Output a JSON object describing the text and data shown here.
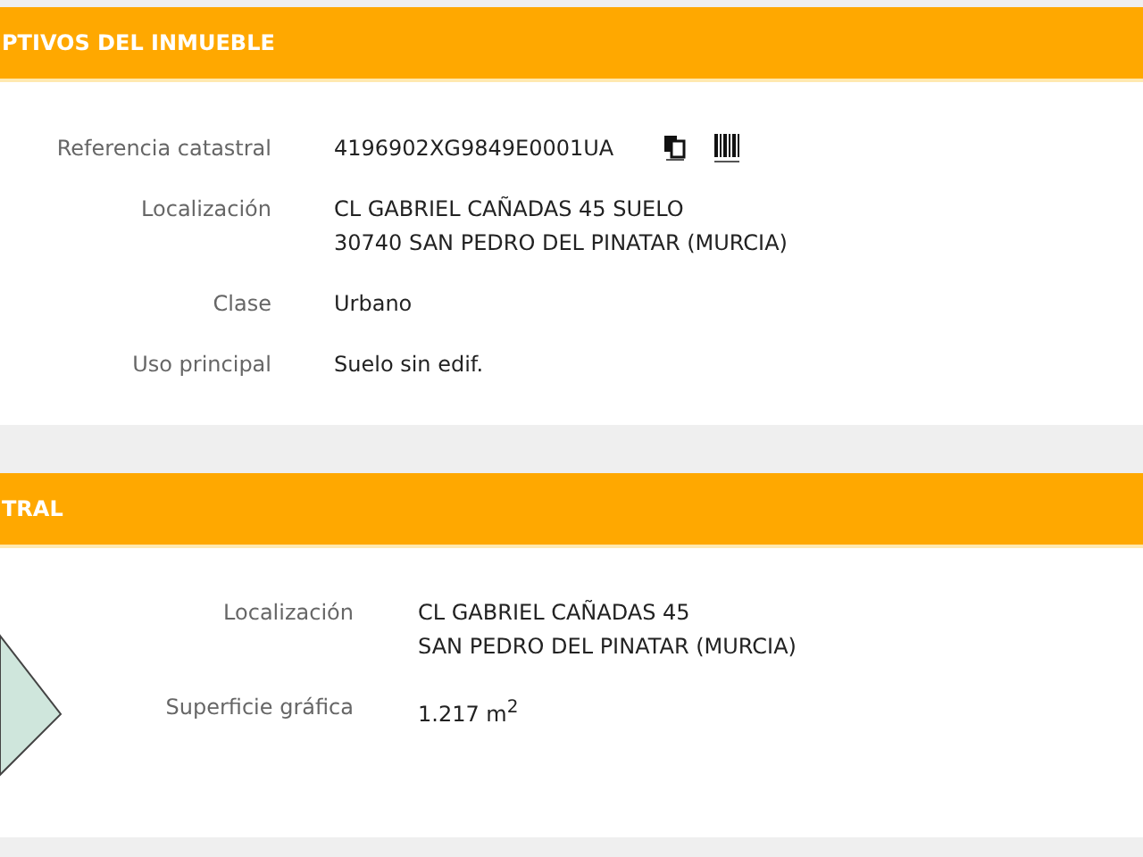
{
  "sections": [
    {
      "title": "PTIVOS DEL INMUEBLE",
      "kind": "plain",
      "fields": [
        {
          "label": "Referencia catastral",
          "kind": "reference",
          "lines": [
            "4196902XG9849E0001UA"
          ]
        },
        {
          "label": "Localización",
          "kind": "text",
          "lines": [
            "CL GABRIEL CAÑADAS 45 SUELO",
            "30740 SAN PEDRO DEL PINATAR (MURCIA)"
          ]
        },
        {
          "label": "Clase",
          "kind": "text",
          "lines": [
            "Urbano"
          ]
        },
        {
          "label": "Uso principal",
          "kind": "text",
          "lines": [
            "Suelo sin edif."
          ]
        }
      ]
    },
    {
      "title": "TRAL",
      "kind": "map",
      "fields": [
        {
          "label": "Localización",
          "kind": "text",
          "lines": [
            "CL GABRIEL CAÑADAS 45",
            "SAN PEDRO DEL PINATAR (MURCIA)"
          ]
        },
        {
          "label": "Superficie gráfica",
          "kind": "text",
          "lines": [
            "1.217 m$^{2}$"
          ]
        }
      ]
    }
  ]
}
